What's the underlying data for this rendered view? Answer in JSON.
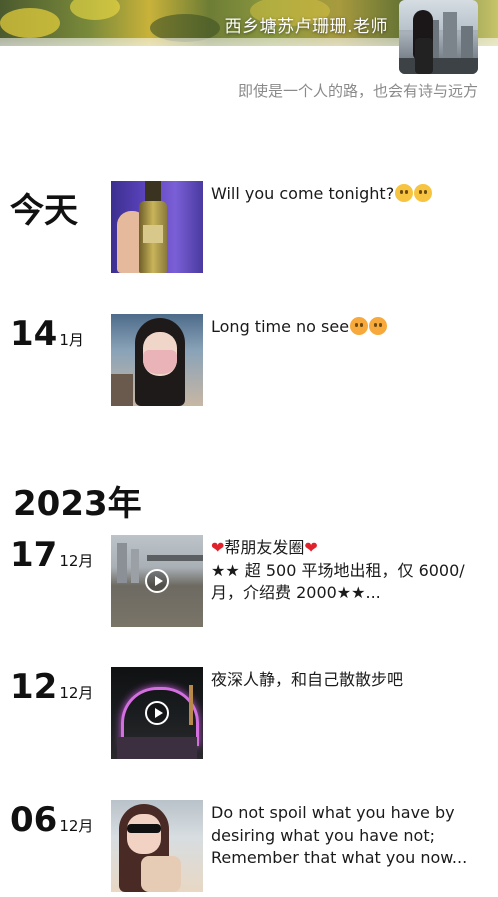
{
  "profile": {
    "nickname": "西乡塘苏卢珊珊.老师",
    "signature": "即使是一个人的路，也会有诗与远方"
  },
  "timeline": {
    "today_label": "今天",
    "year_label": "2023年",
    "posts": [
      {
        "day": "",
        "month": "",
        "text": "Will you come tonight?",
        "thumb": "bottle-photo",
        "is_video": false
      },
      {
        "day": "14",
        "month": "1月",
        "text": "Long time no see",
        "thumb": "selfie-mask-photo",
        "is_video": false
      },
      {
        "day": "17",
        "month": "12月",
        "text_line1": "帮朋友发圈",
        "text_line2": "★★ 超 500 平场地出租，仅 6000/月，介绍费 2000★★...",
        "thumb": "site-video",
        "is_video": true
      },
      {
        "day": "12",
        "month": "12月",
        "text": "夜深人静，和自己散散步吧",
        "thumb": "night-lights-video",
        "is_video": true
      },
      {
        "day": "06",
        "month": "12月",
        "text": "Do not spoil what you have by desiring what you have not; Remember that what you now...",
        "thumb": "sunglasses-selfie-photo",
        "is_video": false
      }
    ]
  },
  "icons": {
    "emoji": "smiling-face-icon",
    "heart": "red-heart-icon",
    "play": "play-icon"
  }
}
